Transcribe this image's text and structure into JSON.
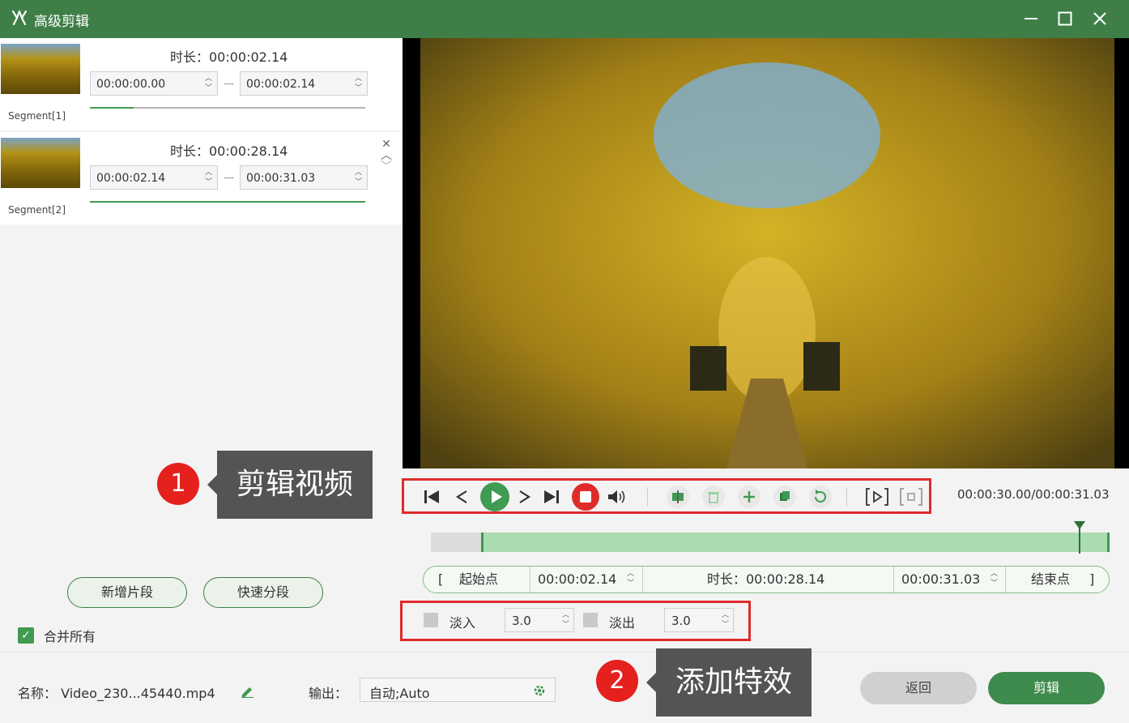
{
  "window": {
    "title": "高级剪辑",
    "accent": "#3f7f47"
  },
  "segments": [
    {
      "label": "Segment[1]",
      "duration": "时长：00:00:02.14",
      "start": "00:00:00.00",
      "end": "00:00:02.14",
      "progress": 0.16
    },
    {
      "label": "Segment[2]",
      "duration": "时长：00:00:28.14",
      "start": "00:00:02.14",
      "end": "00:00:31.03",
      "progress": 1.0
    }
  ],
  "left_buttons": {
    "add_segment": "新增片段",
    "quick_split": "快速分段"
  },
  "merge": {
    "label": "合并所有",
    "checked": true
  },
  "player": {
    "timecode": "00:00:30.00/00:00:31.03",
    "playhead_fraction": 0.955
  },
  "range": {
    "start_label": "起始点",
    "start": "00:00:02.14",
    "duration": "时长：00:00:28.14",
    "end": "00:00:31.03",
    "end_label": "结束点"
  },
  "fade": {
    "in_label": "淡入",
    "in_value": "3.0",
    "out_label": "淡出",
    "out_value": "3.0"
  },
  "footer": {
    "name_label": "名称：",
    "name_value": "Video_230...45440.mp4",
    "output_label": "输出：",
    "output_value": "自动;Auto",
    "back": "返回",
    "cut": "剪辑"
  },
  "annotations": [
    {
      "number": "1",
      "text": "剪辑视频"
    },
    {
      "number": "2",
      "text": "添加特效"
    }
  ]
}
